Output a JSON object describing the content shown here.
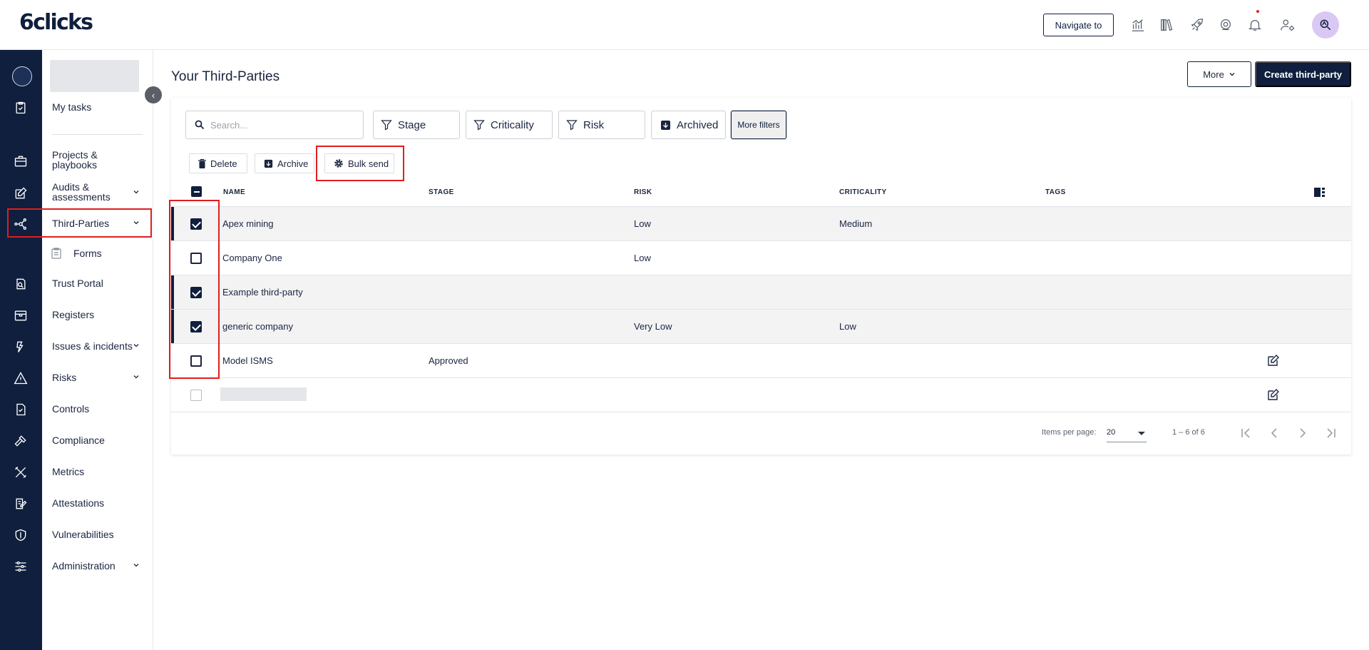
{
  "app": {
    "logo": "6clicks"
  },
  "topbar": {
    "navigate_label": "Navigate to",
    "icons": [
      "analytics-icon",
      "library-icon",
      "rocket-icon",
      "help-icon",
      "bell-icon",
      "user-settings-icon",
      "search-avatar-icon"
    ]
  },
  "sidebar": {
    "items": [
      {
        "label": "My tasks"
      },
      {
        "label": "Projects & playbooks"
      },
      {
        "label": "Audits & assessments"
      },
      {
        "label": "Third-Parties"
      },
      {
        "label": "Forms"
      },
      {
        "label": "Trust Portal"
      },
      {
        "label": "Registers"
      },
      {
        "label": "Issues & incidents"
      },
      {
        "label": "Risks"
      },
      {
        "label": "Controls"
      },
      {
        "label": "Compliance"
      },
      {
        "label": "Metrics"
      },
      {
        "label": "Attestations"
      },
      {
        "label": "Vulnerabilities"
      },
      {
        "label": "Administration"
      }
    ]
  },
  "page": {
    "title": "Your Third-Parties",
    "more_label": "More",
    "create_label": "Create third-party"
  },
  "filters": {
    "search_placeholder": "Search...",
    "stage": "Stage",
    "criticality": "Criticality",
    "risk": "Risk",
    "archived": "Archived",
    "more_filters": "More filters"
  },
  "actions": {
    "delete": "Delete",
    "archive": "Archive",
    "bulk_send": "Bulk send"
  },
  "table": {
    "headers": {
      "name": "NAME",
      "stage": "STAGE",
      "risk": "RISK",
      "criticality": "CRITICALITY",
      "tags": "TAGS"
    },
    "rows": [
      {
        "name": "Apex mining",
        "stage": "",
        "risk": "Low",
        "criticality": "Medium",
        "tags": "",
        "selected": true
      },
      {
        "name": "Company One",
        "stage": "",
        "risk": "Low",
        "criticality": "",
        "tags": "",
        "selected": false
      },
      {
        "name": "Example third-party",
        "stage": "",
        "risk": "",
        "criticality": "",
        "tags": "",
        "selected": true
      },
      {
        "name": "generic company",
        "stage": "",
        "risk": "Very Low",
        "criticality": "Low",
        "tags": "",
        "selected": true
      },
      {
        "name": "Model ISMS",
        "stage": "Approved",
        "risk": "",
        "criticality": "",
        "tags": "",
        "selected": false
      }
    ]
  },
  "pagination": {
    "items_per_page_label": "Items per page:",
    "items_per_page": "20",
    "range": "1 – 6 of 6"
  },
  "colors": {
    "primary": "#0f1f3d",
    "highlight": "#e01e1e",
    "selected_row": "#f3f3f4"
  }
}
